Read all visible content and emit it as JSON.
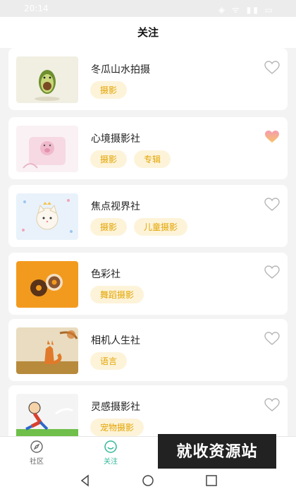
{
  "status_bar": {
    "time": "20:14",
    "icons": "◈ ᯤ ▮▮ ▭"
  },
  "header": {
    "title": "关注"
  },
  "cards": [
    {
      "title": "冬瓜山水拍摄",
      "tags": [
        "摄影"
      ],
      "liked": false,
      "thumb_icon": "avocado-illustration"
    },
    {
      "title": "心境摄影社",
      "tags": [
        "摄影",
        "专辑"
      ],
      "liked": true,
      "thumb_icon": "pig-illustration"
    },
    {
      "title": "焦点视界社",
      "tags": [
        "摄影",
        "儿童摄影"
      ],
      "liked": false,
      "thumb_icon": "cat-pattern-illustration"
    },
    {
      "title": "色彩社",
      "tags": [
        "舞蹈摄影"
      ],
      "liked": false,
      "thumb_icon": "donuts-illustration"
    },
    {
      "title": "相机人生社",
      "tags": [
        "语言"
      ],
      "liked": false,
      "thumb_icon": "fox-illustration"
    },
    {
      "title": "灵感摄影社",
      "tags": [
        "宠物摄影"
      ],
      "liked": false,
      "thumb_icon": "kid-running-illustration"
    }
  ],
  "tabbar": {
    "tabs": [
      {
        "label": "社区",
        "icon": "compass-icon",
        "active": false
      },
      {
        "label": "关注",
        "icon": "smile-icon",
        "active": true
      }
    ]
  },
  "watermark": {
    "text": "就收资源站"
  },
  "colors": {
    "accent": "#33b89a",
    "tag_bg": "#fdf3d9",
    "tag_text": "#e3a400",
    "heart_liked": "#f06b8e"
  }
}
